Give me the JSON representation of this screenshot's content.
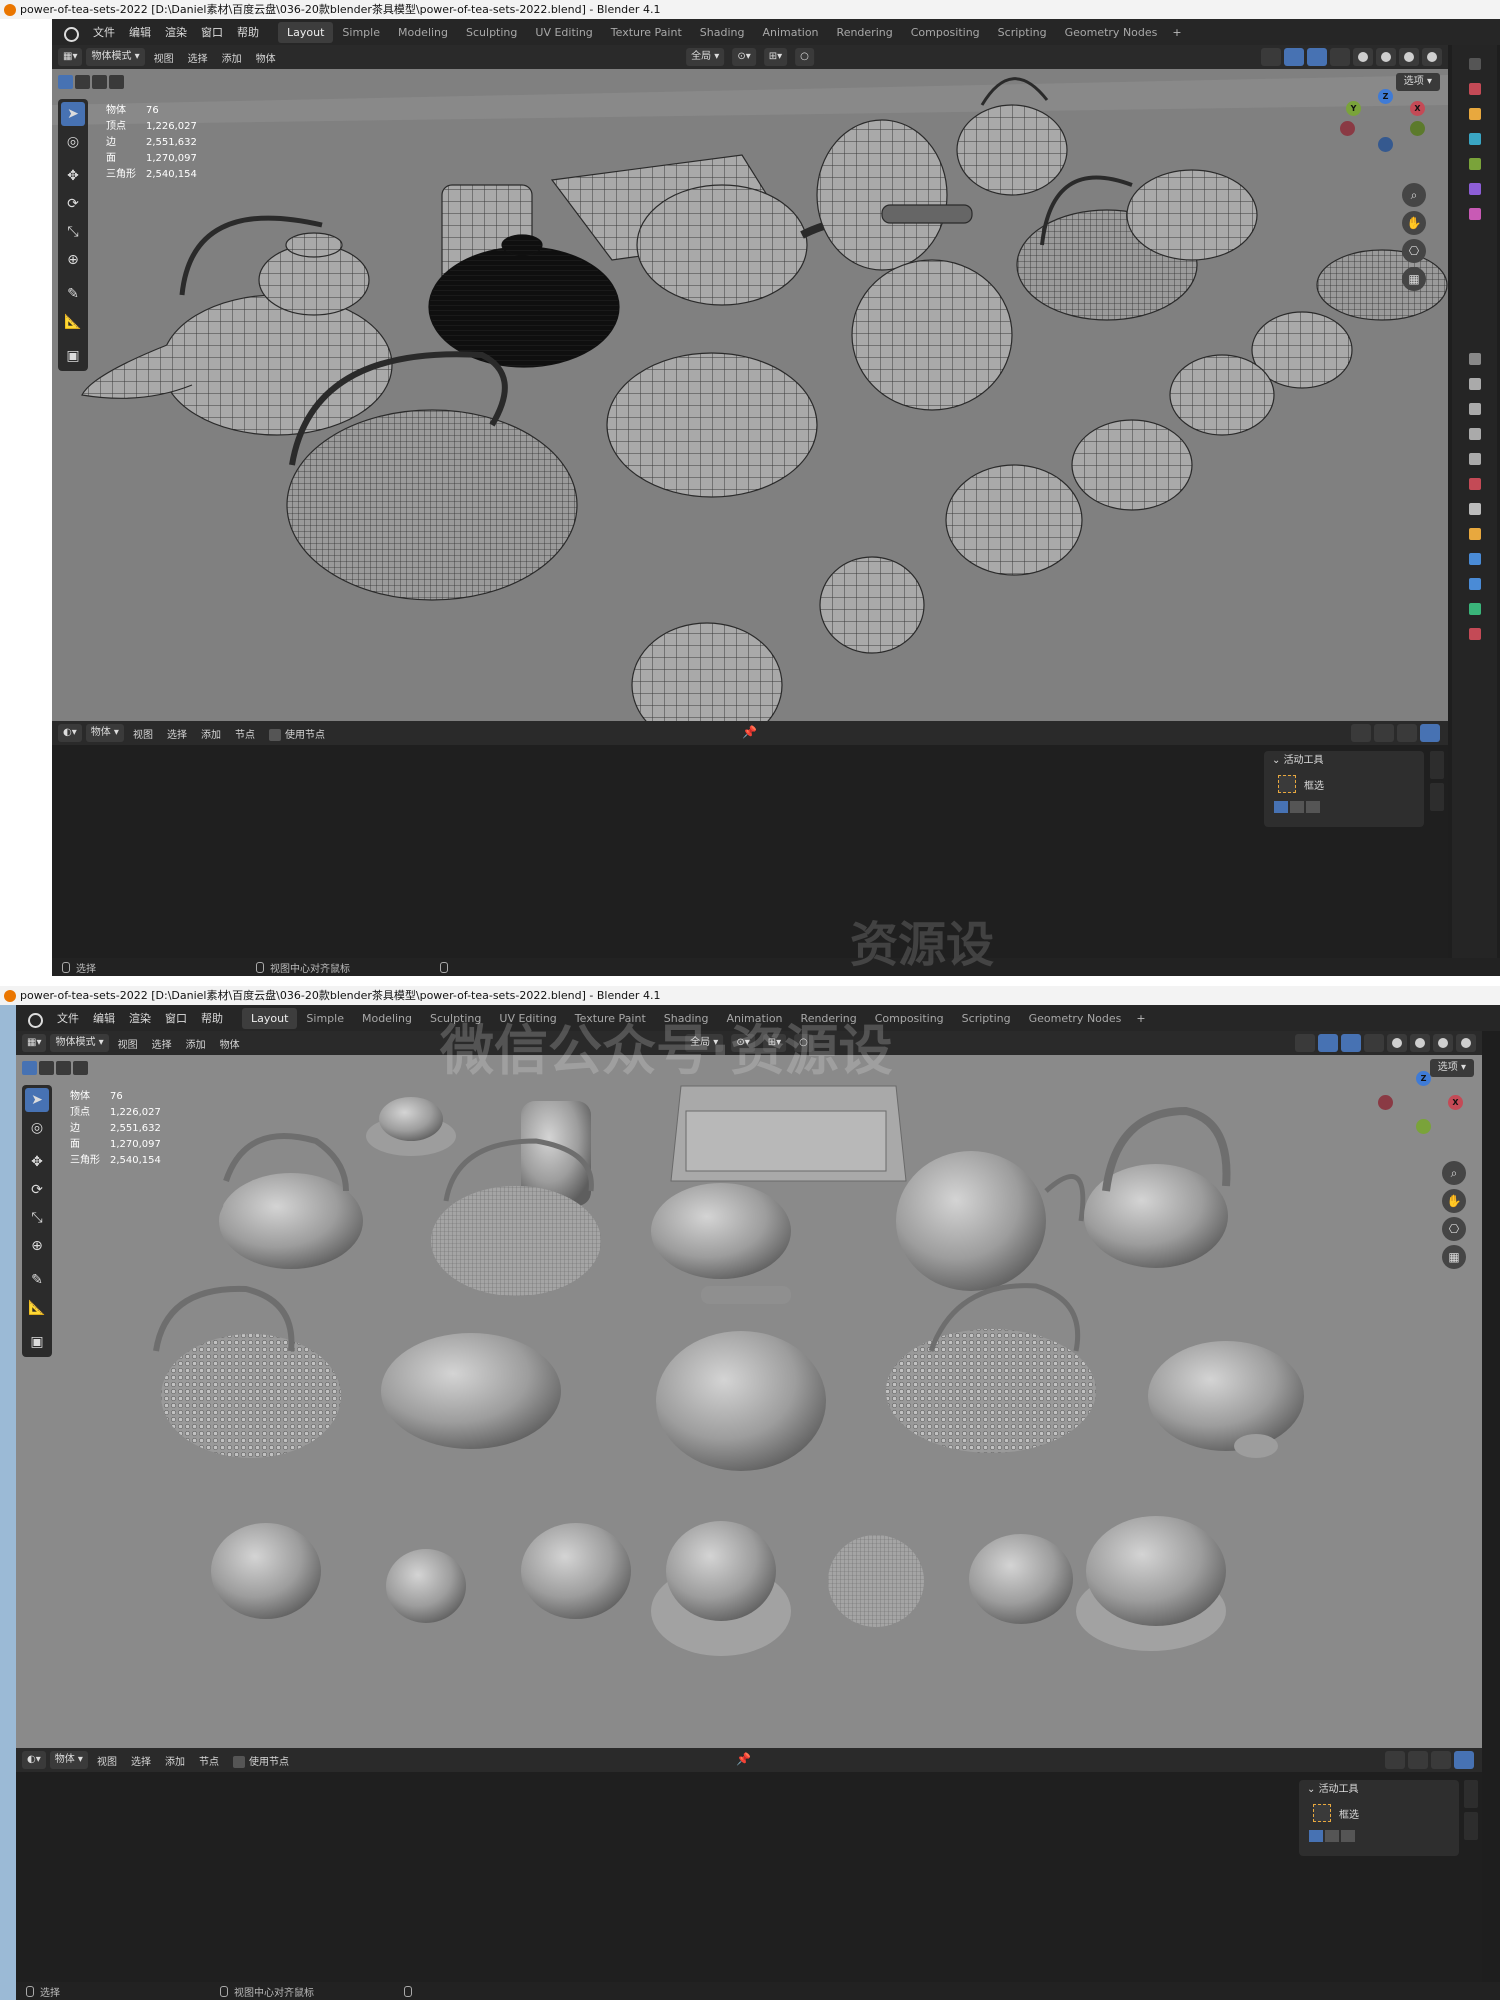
{
  "window": {
    "title": "power-of-tea-sets-2022 [D:\\Daniel素材\\百度云盘\\036-20款blender茶具模型\\power-of-tea-sets-2022.blend] - Blender 4.1"
  },
  "menus": [
    "文件",
    "编辑",
    "渲染",
    "窗口",
    "帮助"
  ],
  "workspaces": [
    "Layout",
    "Simple",
    "Modeling",
    "Sculpting",
    "UV Editing",
    "Texture Paint",
    "Shading",
    "Animation",
    "Rendering",
    "Compositing",
    "Scripting",
    "Geometry Nodes"
  ],
  "active_workspace": "Layout",
  "workspace_add": "+",
  "viewport": {
    "mode": "物体模式",
    "menus": [
      "视图",
      "选择",
      "添加",
      "物体"
    ],
    "orientation": "全局",
    "options": "选项"
  },
  "stats": [
    {
      "label": "物体",
      "value": "76"
    },
    {
      "label": "顶点",
      "value": "1,226,027"
    },
    {
      "label": "边",
      "value": "2,551,632"
    },
    {
      "label": "面",
      "value": "1,270,097"
    },
    {
      "label": "三角形",
      "value": "2,540,154"
    }
  ],
  "gizmo": {
    "x": "X",
    "y": "Y",
    "z": "Z"
  },
  "node_editor": {
    "type": "物体",
    "menus": [
      "视图",
      "选择",
      "添加",
      "节点"
    ],
    "use_nodes": "使用节点"
  },
  "active_tool_panel": {
    "title": "活动工具",
    "tool": "框选"
  },
  "statusbar": {
    "select": "选择",
    "center_view": "视图中心对齐鼠标"
  },
  "watermark": {
    "text1": "资源设",
    "text2": "微信公众号·资源设"
  },
  "colors": {
    "accent": "#4772b3",
    "viewport_bg": "#7f7f7f",
    "x_axis": "#c44a56",
    "y_axis": "#7aa33a",
    "z_axis": "#3f7bd6"
  }
}
